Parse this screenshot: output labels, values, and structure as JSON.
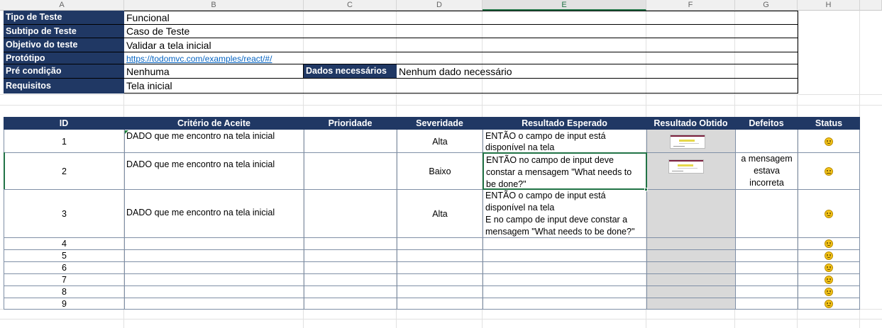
{
  "columns": [
    "A",
    "B",
    "C",
    "D",
    "E",
    "F",
    "G",
    "H"
  ],
  "info": {
    "tipo_label": "Tipo de Teste",
    "tipo_value": "Funcional",
    "subtipo_label": "Subtipo de Teste",
    "subtipo_value": "Caso de Teste",
    "objetivo_label": "Objetivo do teste",
    "objetivo_value": "Validar a tela inicial",
    "prototipo_label": "Protótipo",
    "prototipo_value": "https://todomvc.com/examples/react/#/",
    "precondicao_label": "Pré condição",
    "precondicao_value": "Nenhuma",
    "dados_label": "Dados necessários",
    "dados_value": "Nenhum dado necessário",
    "requisitos_label": "Requisitos",
    "requisitos_value": "Tela inicial"
  },
  "table": {
    "headers": {
      "id": "ID",
      "criterio": "Critério de Aceite",
      "prioridade": "Prioridade",
      "severidade": "Severidade",
      "esperado": "Resultado Esperado",
      "obtido": "Resultado Obtido",
      "defeitos": "Defeitos",
      "status": "Status"
    },
    "rows": [
      {
        "id": "1",
        "criterio": "DADO que me encontro na tela inicial",
        "prioridade": "",
        "severidade": "Alta",
        "esperado": "ENTÃO o campo de input está disponível na tela",
        "defeitos": "",
        "status": "happy"
      },
      {
        "id": "2",
        "criterio": "DADO que me encontro na tela inicial",
        "prioridade": "",
        "severidade": "Baixo",
        "esperado": "ENTÃO no campo de input deve constar a mensagem \"What needs to be done?\"",
        "defeitos": "a mensagem estava incorreta",
        "status": "neutral"
      },
      {
        "id": "3",
        "criterio": "DADO que me encontro na tela inicial",
        "prioridade": "",
        "severidade": "Alta",
        "esperado_line1": "ENTÃO o campo de input está disponível na tela",
        "esperado_line2": "E no campo de input deve constar a mensagem \"What needs to be done?\"",
        "defeitos": "",
        "status": "happy"
      },
      {
        "id": "4",
        "status": "happy"
      },
      {
        "id": "5",
        "status": "happy"
      },
      {
        "id": "6",
        "status": "happy"
      },
      {
        "id": "7",
        "status": "happy"
      },
      {
        "id": "8",
        "status": "happy"
      },
      {
        "id": "9",
        "status": "happy"
      }
    ]
  },
  "icons": {
    "status_happy": "smiley-face-icon",
    "status_neutral": "neutral-face-icon",
    "screenshot": "screenshot-thumbnail"
  },
  "colors": {
    "header_bg": "#203864",
    "header_fg": "#ffffff",
    "link": "#0563c1",
    "obtido_bg": "#d9d9d9",
    "selection": "#217346"
  }
}
